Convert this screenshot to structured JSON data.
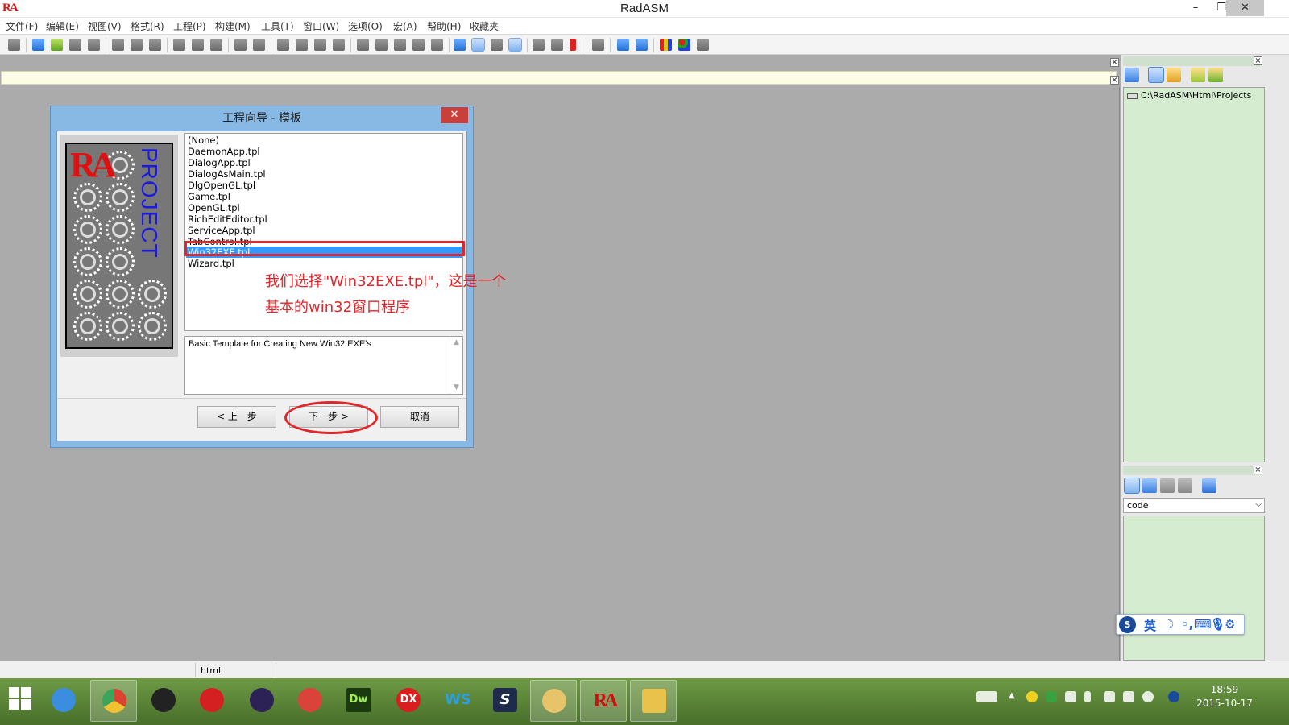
{
  "window": {
    "title": "RadASM",
    "logo": "RA"
  },
  "menu": [
    "文件(F)",
    "编辑(E)",
    "视图(V)",
    "格式(R)",
    "工程(P)",
    "构建(M)",
    "工具(T)",
    "窗口(W)",
    "选项(O)",
    "宏(A)",
    "帮助(H)",
    "收藏夹"
  ],
  "dialog": {
    "title": "工程向导 - 模板",
    "picture": {
      "logo": "RA",
      "text": "PROJECT"
    },
    "templates": [
      "(None)",
      "DaemonApp.tpl",
      "DialogApp.tpl",
      "DialogAsMain.tpl",
      "DlgOpenGL.tpl",
      "Game.tpl",
      "OpenGL.tpl",
      "RichEditEditor.tpl",
      "ServiceApp.tpl",
      "TabControl.tpl",
      "Win32EXE.tpl",
      "Wizard.tpl"
    ],
    "selected_template": "Win32EXE.tpl",
    "description": "Basic Template for Creating New Win32 EXE's",
    "buttons": {
      "back": "< 上一步",
      "next": "下一步 >",
      "cancel": "取消"
    },
    "annotation": {
      "line1": "我们选择\"Win32EXE.tpl\"，这是一个",
      "line2": "基本的win32窗口程序"
    }
  },
  "right_panel": {
    "project_path": "C:\\RadASM\\Html\\Projects",
    "code_select": "code"
  },
  "ime": {
    "logo": "S",
    "lang": "英"
  },
  "statusbar": {
    "mode": "html"
  },
  "taskbar": {
    "clock_time": "18:59",
    "clock_date": "2015-10-17",
    "apps": [
      {
        "name": "start-icon",
        "label": ""
      },
      {
        "name": "cloud-app-icon",
        "label": "",
        "color": "#3b8de0"
      },
      {
        "name": "chrome-icon",
        "label": "",
        "color": "#d9432f"
      },
      {
        "name": "qq-icon",
        "label": "",
        "color": "#222222"
      },
      {
        "name": "app-red-icon",
        "label": "",
        "color": "#d42020"
      },
      {
        "name": "eclipse-icon",
        "label": "",
        "color": "#2c2255"
      },
      {
        "name": "masm-icon",
        "label": "",
        "color": "#d9433a"
      },
      {
        "name": "dreamweaver-icon",
        "label": "Dw",
        "color": "#1b3a0f"
      },
      {
        "name": "dx-icon",
        "label": "DX",
        "color": "#d81e1e"
      },
      {
        "name": "ws-icon",
        "label": "WS",
        "color": "#2aa0e0"
      },
      {
        "name": "s-app-icon",
        "label": "S",
        "color": "#1e2b4a"
      },
      {
        "name": "paint-icon",
        "label": "",
        "color": "#e7c46a"
      },
      {
        "name": "radasm-icon",
        "label": "RA",
        "color": "#cc1010"
      },
      {
        "name": "explorer-icon",
        "label": "",
        "color": "#e8c24a"
      }
    ]
  }
}
